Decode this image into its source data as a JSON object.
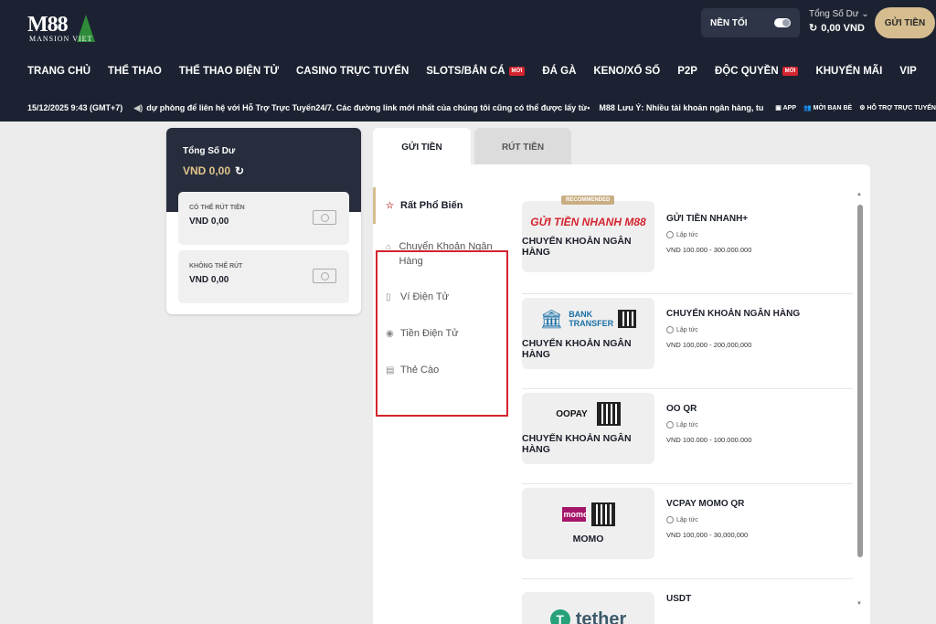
{
  "header": {
    "logo_text": "M88",
    "logo_sub": "MANSION VIET",
    "dark_mode_label": "NỀN TỐI",
    "balance_label": "Tổng Số Dư",
    "balance_value": "0,00 VND",
    "deposit_button": "GỬI TIỀN"
  },
  "nav": [
    {
      "label": "TRANG CHỦ"
    },
    {
      "label": "THỂ THAO"
    },
    {
      "label": "THỂ THAO ĐIỆN TỬ"
    },
    {
      "label": "CASINO TRỰC TUYẾN"
    },
    {
      "label": "SLOTS/BẮN CÁ",
      "badge": "MỚI"
    },
    {
      "label": "ĐÁ GÀ"
    },
    {
      "label": "KENO/XỔ SỐ"
    },
    {
      "label": "P2P"
    },
    {
      "label": "ĐỘC QUYỀN",
      "badge": "MỚI"
    },
    {
      "label": "KHUYẾN MÃI"
    },
    {
      "label": "VIP"
    }
  ],
  "ticker": {
    "time": "15/12/2025 9:43 (GMT+7)",
    "message": "dự phòng để liên hệ với Hỗ Trợ Trực Tuyến24/7. Các đường link mới nhất của chúng tôi cũng có thể được lấy từ liên kết này.",
    "message2": "M88 Lưu Ý: Nhiều tài khoản ngân hàng, tu",
    "links": [
      "APP",
      "MỜI BẠN BÈ",
      "HỖ TRỢ TRỰC TUYẾN"
    ]
  },
  "wallet": {
    "total_label": "Tổng Số Dư",
    "total_value": "VND 0,00",
    "withdrawable_label": "CÓ THỂ RÚT TIỀN",
    "withdrawable_value": "VND 0,00",
    "non_withdrawable_label": "KHÔNG THỂ RÚT",
    "non_withdrawable_value": "VND 0,00"
  },
  "tabs": {
    "deposit": "GỬI TIỀN",
    "withdraw": "RÚT TIỀN"
  },
  "categories": [
    {
      "label": "Rất Phổ Biến",
      "icon": "star-icon"
    },
    {
      "label": "Chuyển Khoản Ngân Hàng",
      "icon": "bank-icon"
    },
    {
      "label": "Ví Điện Tử",
      "icon": "wallet-icon"
    },
    {
      "label": "Tiền Điện Tử",
      "icon": "crypto-icon"
    },
    {
      "label": "Thẻ Cào",
      "icon": "card-icon"
    }
  ],
  "methods": [
    {
      "brand": "GỬI TIỀN NHANH M88",
      "logo_caption": "CHUYỂN KHOẢN NGÂN HÀNG",
      "badge": "RECOMMENDED",
      "name": "GỬI TIỀN NHANH+",
      "speed": "Lập tức",
      "range": "VND 100.000 - 300.000.000"
    },
    {
      "brand": "BANK TRANSFER",
      "logo_caption": "CHUYỂN KHOẢN NGÂN HÀNG",
      "name": "CHUYỂN KHOẢN NGÂN HÀNG",
      "speed": "Lập tức",
      "range": "VND 100,000 - 200,000,000"
    },
    {
      "brand": "OOPAY",
      "logo_caption": "CHUYỂN KHOẢN NGÂN HÀNG",
      "name": "OO QR",
      "speed": "Lập tức",
      "range": "VND 100.000 - 100.000.000"
    },
    {
      "brand": "momo",
      "logo_caption": "MOMO",
      "name": "VCPAY MOMO QR",
      "speed": "Lập tức",
      "range": "VND 100,000 - 30,000,000"
    },
    {
      "brand": "tether",
      "logo_caption": "",
      "name": "USDT",
      "speed": "",
      "range": ""
    }
  ],
  "colors": {
    "header_bg": "#1c2231",
    "gold": "#d6bd8f",
    "highlight": "#d4242f"
  }
}
